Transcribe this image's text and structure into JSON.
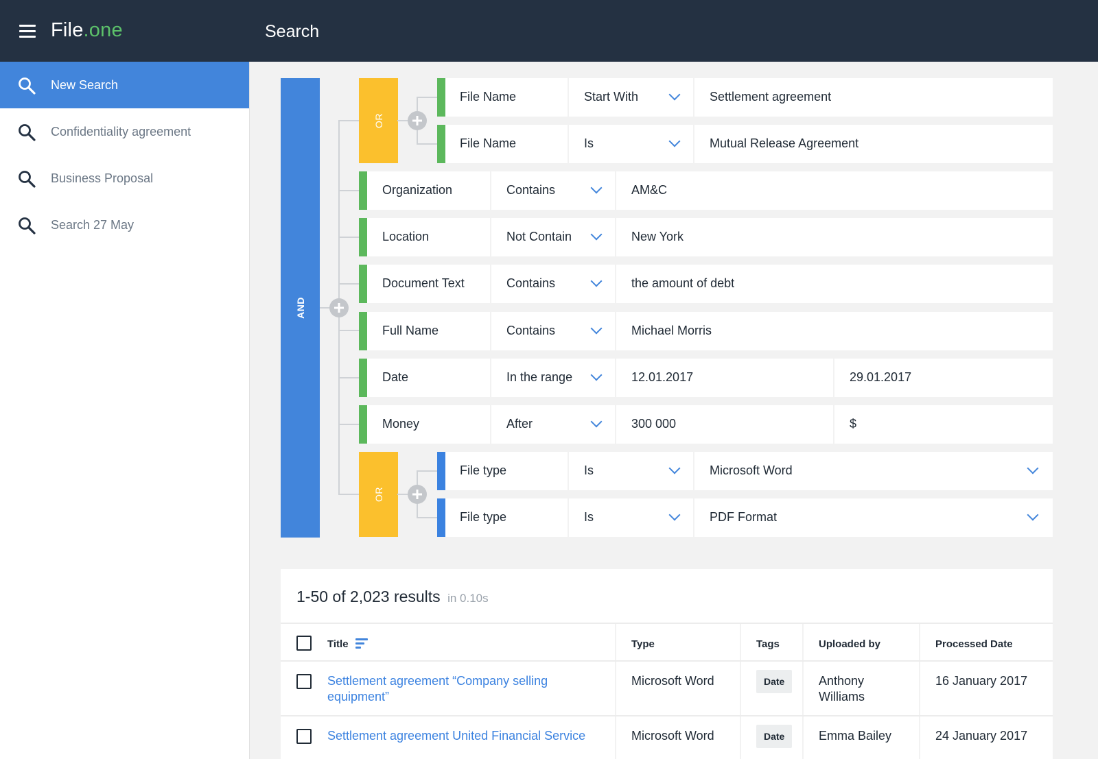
{
  "header": {
    "logo_main": "File",
    "logo_accent": ".one",
    "title": "Search"
  },
  "sidebar": {
    "items": [
      {
        "label": "New Search",
        "active": true
      },
      {
        "label": "Confidentiality agreement"
      },
      {
        "label": "Business Proposal"
      },
      {
        "label": "Search 27 May"
      }
    ]
  },
  "query": {
    "and_label": "AND",
    "or_label": "OR",
    "or_group_1": [
      {
        "field": "File Name",
        "operator": "Start With",
        "value": "Settlement agreement"
      },
      {
        "field": "File Name",
        "operator": "Is",
        "value": "Mutual Release Agreement"
      }
    ],
    "rows": [
      {
        "field": "Organization",
        "operator": "Contains",
        "value": "AM&C"
      },
      {
        "field": "Location",
        "operator": "Not Contain",
        "value": "New York"
      },
      {
        "field": "Document Text",
        "operator": "Contains",
        "value": "the amount of debt"
      },
      {
        "field": "Full Name",
        "operator": "Contains",
        "value": "Michael Morris"
      },
      {
        "field": "Date",
        "operator": "In the range",
        "value": "12.01.2017",
        "value2": "29.01.2017"
      },
      {
        "field": "Money",
        "operator": "After",
        "value": "300 000",
        "value2": "$"
      }
    ],
    "or_group_2": [
      {
        "field": "File type",
        "operator": "Is",
        "value": "Microsoft Word"
      },
      {
        "field": "File type",
        "operator": "Is",
        "value": "PDF Format"
      }
    ]
  },
  "results": {
    "count": "1-50 of 2,023 results",
    "time": "in 0.10s",
    "columns": {
      "title": "Title",
      "type": "Type",
      "tags": "Tags",
      "uploaded_by": "Uploaded by",
      "processed_date": "Processed Date"
    },
    "rows": [
      {
        "title_line1": "Settlement agreement “Company selling",
        "title_line2": "equipment”",
        "type": "Microsoft Word",
        "tag": "Date",
        "uploaded_line1": "Anthony",
        "uploaded_line2": "Williams",
        "date": "16 January 2017"
      },
      {
        "title_line1": "Settlement agreement United Financial Service",
        "type": "Microsoft Word",
        "tag": "Date",
        "uploaded_line1": "Emma Bailey",
        "date": "24 January 2017"
      }
    ]
  },
  "colors": {
    "topbar": "#243142",
    "accent_blue": "#4285db",
    "accent_green": "#5cc16a",
    "or_yellow": "#fbc02d"
  },
  "icons": [
    "menu-icon",
    "search-icon",
    "plus-icon",
    "chevron-down-icon",
    "sort-icon",
    "checkbox-icon"
  ]
}
